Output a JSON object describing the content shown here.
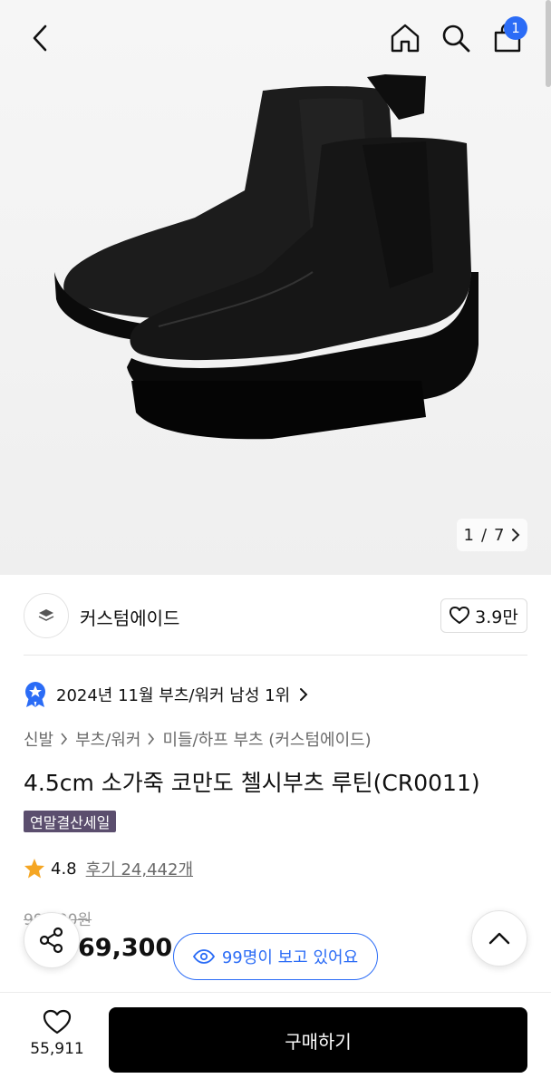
{
  "hero": {
    "image_label": "black chelsea boots",
    "pager_current": "1",
    "pager_sep": "/",
    "pager_total": "7"
  },
  "header": {
    "cart_count": "1"
  },
  "brand": {
    "name": "커스텀에이드",
    "likes": "3.9만"
  },
  "ranking": {
    "text": "2024년 11월 부츠/워커 남성 1위"
  },
  "breadcrumb": [
    "신발",
    "부츠/워커",
    "미들/하프 부츠 (커스텀에이드)"
  ],
  "product": {
    "title": "4.5cm 소가죽 코만도 첼시부츠 루틴(CR0011)",
    "badge": "연말결산세일",
    "rating": "4.8",
    "reviews": "후기 24,442개",
    "original_price": "99,000원",
    "sale_price": "69,300"
  },
  "viewers": {
    "text": "99명이 보고 있어요"
  },
  "bottom": {
    "wish_count": "55,911",
    "buy_label": "구매하기"
  },
  "colors": {
    "accent_blue": "#2b6cf6",
    "badge_purple": "#5b4e6e",
    "star": "#f5a623"
  }
}
